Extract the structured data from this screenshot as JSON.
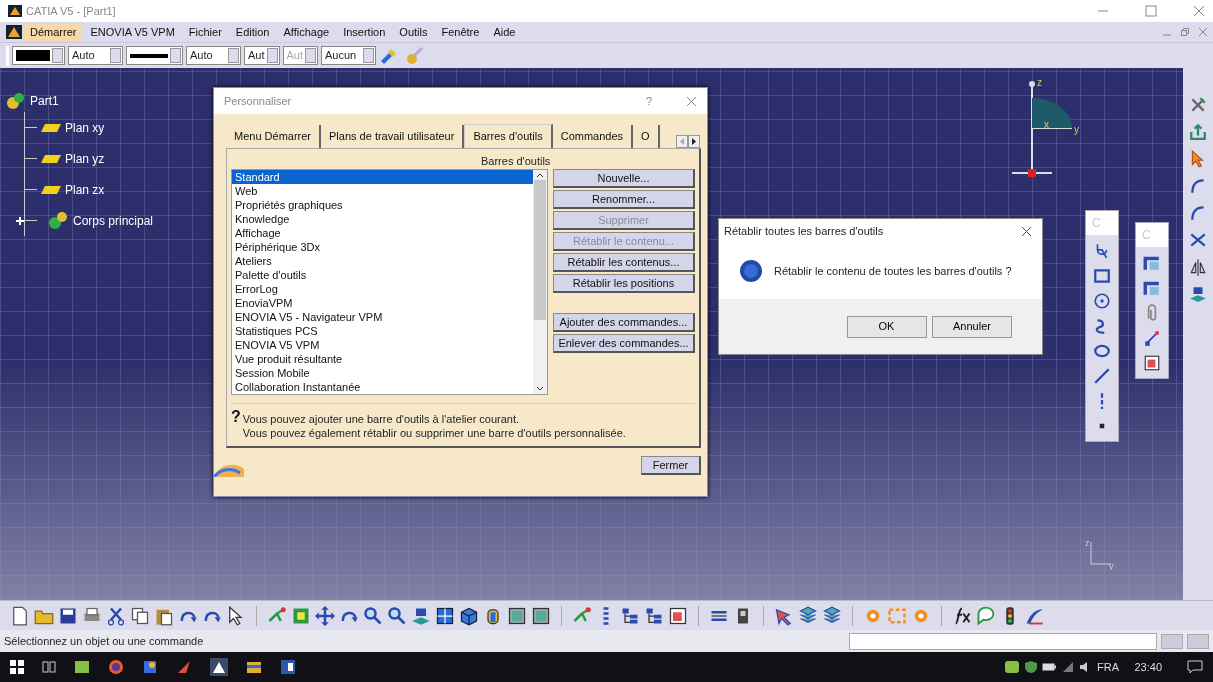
{
  "window": {
    "title": "CATIA V5 - [Part1]"
  },
  "menu": [
    {
      "label": "Démarrer",
      "selected": true
    },
    {
      "label": "ENOVIA V5 VPM",
      "selected": false
    },
    {
      "label": "Fichier",
      "selected": false
    },
    {
      "label": "Edition",
      "selected": false
    },
    {
      "label": "Affichage",
      "selected": false
    },
    {
      "label": "Insertion",
      "selected": false
    },
    {
      "label": "Outils",
      "selected": false
    },
    {
      "label": "Fenêtre",
      "selected": false
    },
    {
      "label": "Aide",
      "selected": false
    }
  ],
  "format_toolbar": [
    {
      "kind": "swatch"
    },
    {
      "kind": "text",
      "value": "Auto",
      "disabled": false
    },
    {
      "kind": "line"
    },
    {
      "kind": "text",
      "value": "Auto",
      "disabled": false
    },
    {
      "kind": "text",
      "value": "Aut",
      "disabled": false
    },
    {
      "kind": "text",
      "value": "Aut",
      "disabled": true
    },
    {
      "kind": "text",
      "value": "Aucun",
      "disabled": false
    }
  ],
  "tree": {
    "label": "Part1",
    "children": [
      {
        "label": "Plan xy",
        "kind": "plane"
      },
      {
        "label": "Plan yz",
        "kind": "plane"
      },
      {
        "label": "Plan zx",
        "kind": "plane"
      },
      {
        "label": "Corps principal",
        "kind": "body",
        "expanded": false
      }
    ]
  },
  "compass": {
    "labels": [
      "z",
      "x",
      "y"
    ]
  },
  "corner_axis": {
    "labels": [
      "z",
      "y"
    ]
  },
  "floating_toolbars": [
    {
      "title": "C"
    },
    {
      "title": "C"
    }
  ],
  "customize_dialog": {
    "title": "Personnaliser",
    "help": "?",
    "tabs": [
      {
        "label": "Menu Démarrer",
        "selected": false
      },
      {
        "label": "Plans de travail utilisateur",
        "selected": false
      },
      {
        "label": "Barres d'outils",
        "selected": true
      },
      {
        "label": "Commandes",
        "selected": false
      },
      {
        "label": "O",
        "selected": false
      }
    ],
    "list_label": "Barres d'outils",
    "toolbars": [
      {
        "label": "Standard",
        "selected": true
      },
      {
        "label": "Web",
        "selected": false
      },
      {
        "label": "Propriétés graphiques",
        "selected": false
      },
      {
        "label": "Knowledge",
        "selected": false
      },
      {
        "label": "Affichage",
        "selected": false
      },
      {
        "label": "Périphérique 3Dx",
        "selected": false
      },
      {
        "label": "Ateliers",
        "selected": false
      },
      {
        "label": "Palette d'outils",
        "selected": false
      },
      {
        "label": "ErrorLog",
        "selected": false
      },
      {
        "label": "EnoviaVPM",
        "selected": false
      },
      {
        "label": "ENOVIA V5 - Navigateur VPM",
        "selected": false
      },
      {
        "label": "Statistiques PCS",
        "selected": false
      },
      {
        "label": "ENOVIA V5 VPM",
        "selected": false
      },
      {
        "label": "Vue produit résultante",
        "selected": false
      },
      {
        "label": "Session Mobile",
        "selected": false
      },
      {
        "label": "Collaboration Instantanée",
        "selected": false
      }
    ],
    "buttons": [
      {
        "label": "Nouvelle...",
        "disabled": false
      },
      {
        "label": "Renommer...",
        "disabled": false
      },
      {
        "label": "Supprimer",
        "disabled": true
      },
      {
        "label": "Rétablir le contenu...",
        "disabled": true
      },
      {
        "label": "Rétablir les contenus...",
        "disabled": false
      },
      {
        "label": "Rétablir les positions",
        "disabled": false
      }
    ],
    "command_buttons": [
      {
        "label": "Ajouter des commandes...",
        "disabled": false
      },
      {
        "label": "Enlever des commandes...",
        "disabled": false
      }
    ],
    "tip_icon": "?",
    "tip": [
      "Vous pouvez ajouter une barre d'outils à l'atelier courant.",
      "Vous pouvez également rétablir ou supprimer une barre d'outils personnalisée."
    ],
    "close_button": "Fermer"
  },
  "confirm_dialog": {
    "title": "Rétablir toutes les barres d'outils",
    "message": "Rétablir le contenu de toutes les barres d'outils ?",
    "buttons": [
      "OK",
      "Annuler"
    ]
  },
  "status_bar": {
    "message": "Sélectionnez un objet ou une commande"
  },
  "taskbar": {
    "language": "FRA",
    "time": "23:40"
  }
}
